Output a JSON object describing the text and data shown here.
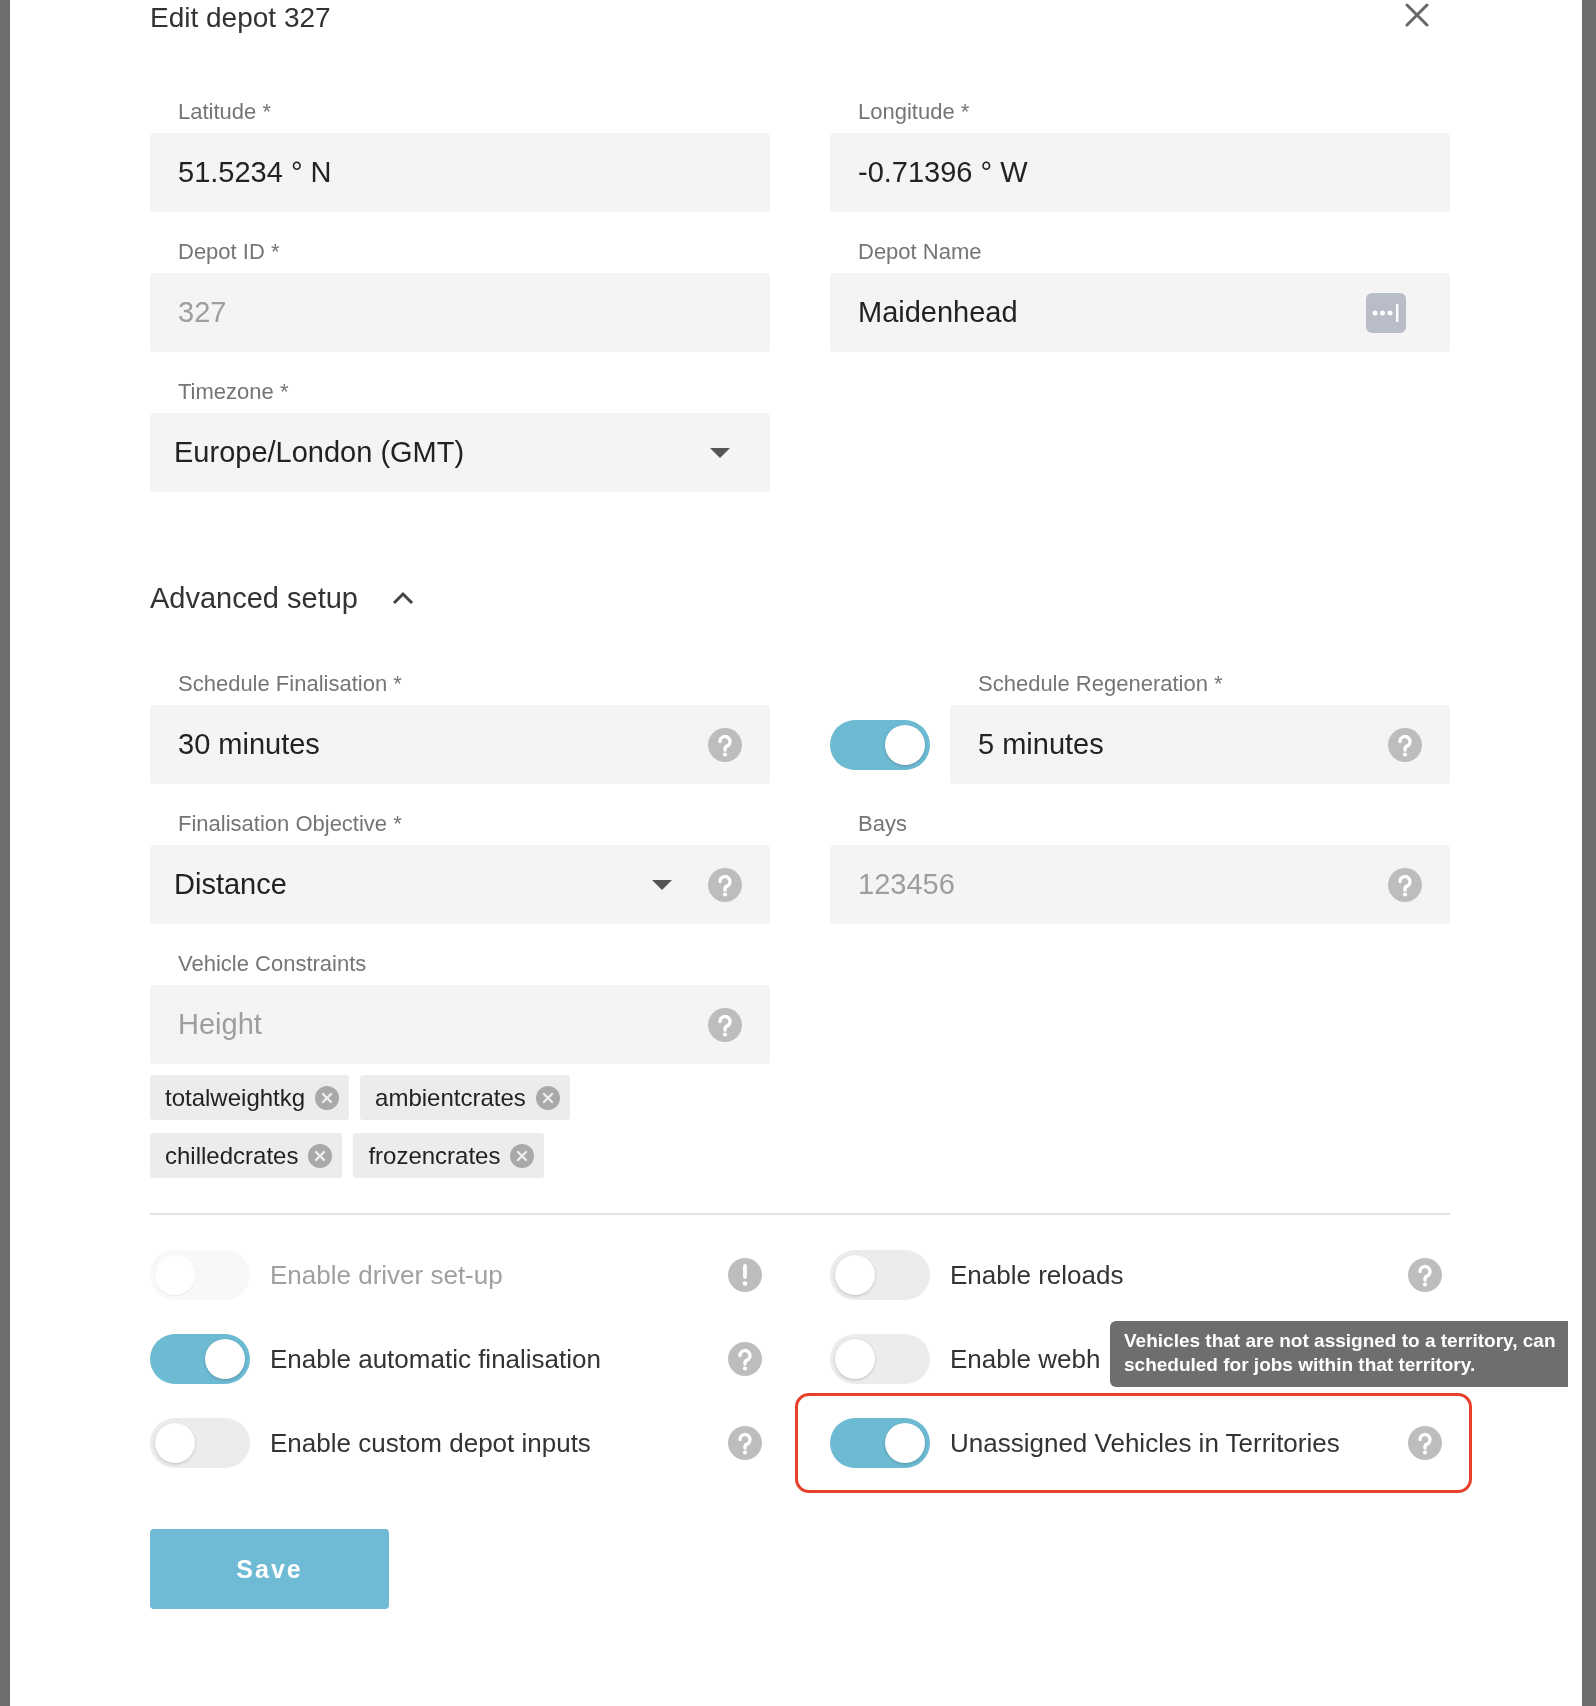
{
  "dialog": {
    "title": "Edit depot 327"
  },
  "fields": [
    {
      "kind": "text",
      "label": "Latitude *",
      "value": "51.5234 ° N",
      "disabled": false
    },
    {
      "kind": "text",
      "label": "Longitude *",
      "value": "-0.71396 ° W",
      "disabled": false
    },
    {
      "kind": "text",
      "label": "Depot ID *",
      "value": "327",
      "disabled": true
    },
    {
      "kind": "text_menu",
      "label": "Depot Name",
      "value": "Maidenhead",
      "disabled": false
    },
    {
      "kind": "select",
      "label": "Timezone *",
      "value": "Europe/London (GMT)",
      "disabled": false
    }
  ],
  "advanced": {
    "label": "Advanced setup",
    "expanded": true,
    "fields": [
      {
        "kind": "text",
        "label": "Schedule Finalisation *",
        "value": "30 minutes"
      },
      {
        "kind": "toggle_text",
        "label": "Schedule Regeneration *",
        "value": "5 minutes",
        "on": true
      },
      {
        "kind": "select",
        "label": "Finalisation Objective *",
        "value": "Distance"
      },
      {
        "kind": "text",
        "label": "Bays",
        "placeholder": "123456"
      },
      {
        "kind": "text",
        "label": "Vehicle Constraints",
        "placeholder": "Height",
        "tags": [
          "totalweightkg",
          "ambientcrates",
          "chilledcrates",
          "frozencrates"
        ]
      }
    ]
  },
  "toggles": [
    {
      "kind": "info",
      "label": "Enable driver set-up",
      "on": false,
      "disabled": true,
      "highlighted": false
    },
    {
      "kind": "help",
      "label": "Enable reloads",
      "on": false,
      "disabled": false,
      "highlighted": false
    },
    {
      "kind": "help",
      "label": "Enable automatic finalisation",
      "on": true,
      "disabled": false,
      "highlighted": false
    },
    {
      "kind": "plain",
      "label": "Enable webh",
      "on": false,
      "disabled": false,
      "highlighted": false
    },
    {
      "kind": "help",
      "label": "Enable custom depot inputs",
      "on": false,
      "disabled": false,
      "highlighted": false
    },
    {
      "kind": "help",
      "label": "Unassigned Vehicles in Territories",
      "on": true,
      "disabled": false,
      "highlighted": true,
      "tooltip": [
        "Vehicles that are not assigned to a territory, can",
        "scheduled for jobs within that territory."
      ]
    }
  ],
  "save": {
    "label": "Save"
  }
}
